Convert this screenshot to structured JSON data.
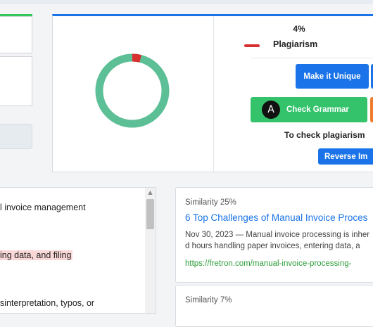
{
  "result": {
    "plagiarism_percent_label": "4%",
    "plagiarism_fraction": 0.04,
    "legend_label": "Plagiarism",
    "colors": {
      "plagiarism": "#d7302f",
      "unique": "#5dbf95",
      "accent": "#1a73e8",
      "grammar": "#34c36b"
    }
  },
  "actions": {
    "make_unique": "Make it Unique",
    "check_grammar": "Check Grammar",
    "grammar_icon": "A",
    "check_text": "To check plagiarism",
    "reverse": "Reverse Im"
  },
  "document": {
    "lines": [
      "l invoice management",
      "ing data, and filing",
      "sinterpretation, typos, or"
    ]
  },
  "matches": [
    {
      "similarity": "Similarity 25%",
      "title": "6 Top Challenges of Manual Invoice Proces",
      "snippet_line1": "Nov 30, 2023 — Manual invoice processing is inher",
      "snippet_line2": "d hours handling paper invoices, entering data, a",
      "url": "https://fretron.com/manual-invoice-processing-"
    },
    {
      "similarity": "Similarity 7%"
    }
  ]
}
